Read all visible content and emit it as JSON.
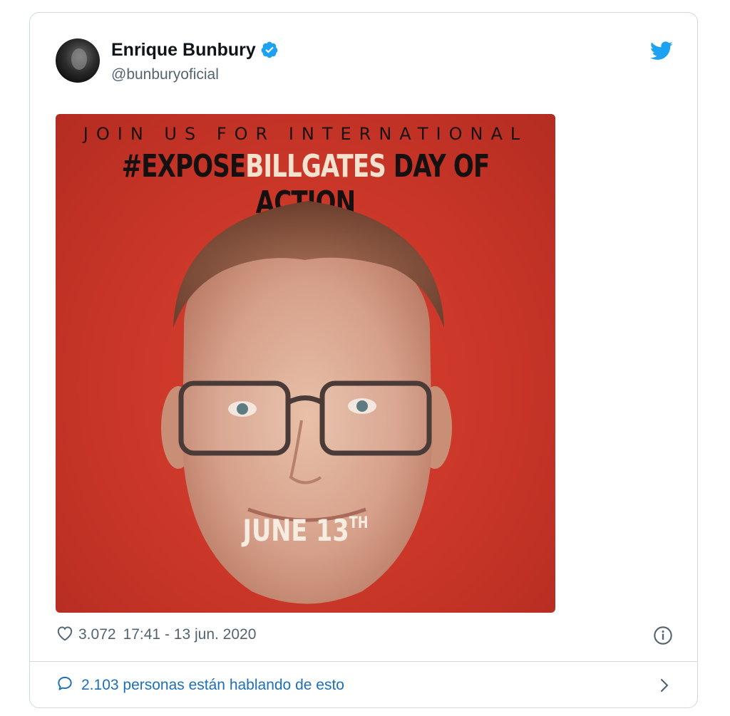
{
  "tweet": {
    "author_name": "Enrique Bunbury",
    "author_handle": "@bunburyoficial",
    "verified": true,
    "brand_color": "#1da1f2"
  },
  "media": {
    "headline_top": "JOIN US FOR INTERNATIONAL",
    "headline_prefix": "#EXPOSE",
    "headline_highlight": "BILLGATES",
    "headline_suffix": " DAY OF ACTION",
    "date_main": "JUNE 13",
    "date_suffix": "TH",
    "background_color": "#c93628"
  },
  "meta": {
    "like_count": "3.072",
    "timestamp": "17:41 - 13 jun. 2020"
  },
  "footer": {
    "conversation_text": "2.103 personas están hablando de esto"
  },
  "icons": {
    "like": "heart-icon",
    "info": "info-icon",
    "reply": "speech-bubble-icon",
    "navigate": "chevron-right-icon",
    "brand": "twitter-bird-icon",
    "verified": "verified-badge-icon"
  }
}
